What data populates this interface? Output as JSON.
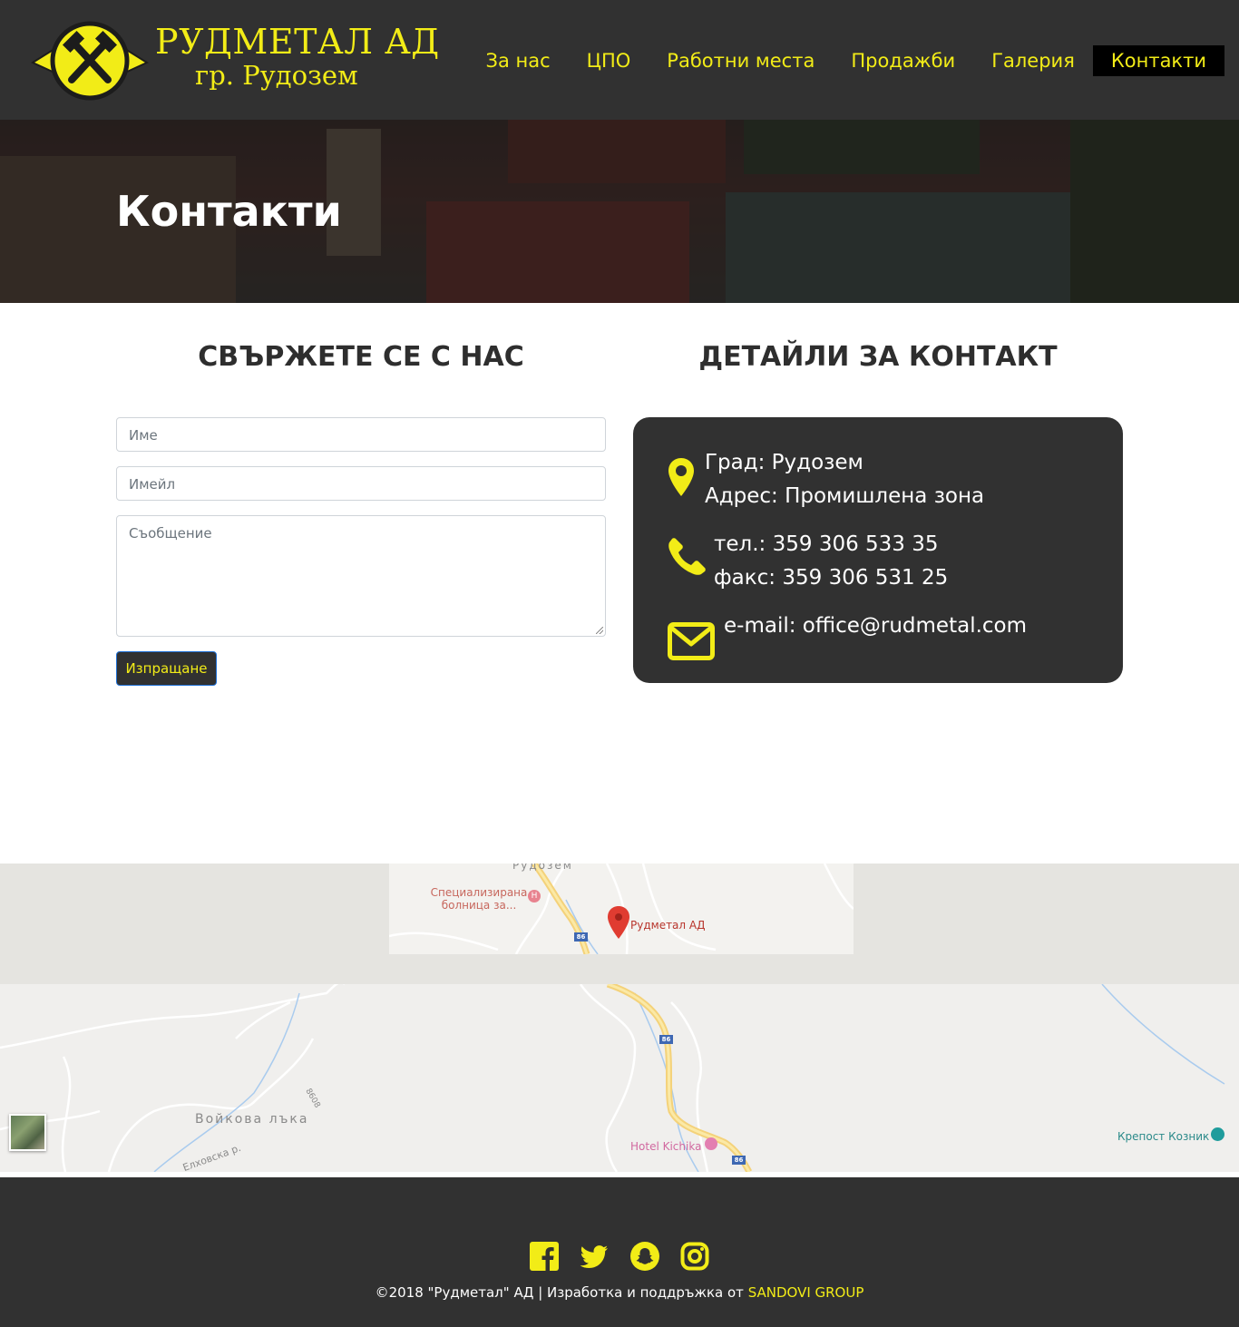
{
  "header": {
    "logo_title": "РУДМЕТАЛ АД",
    "logo_subtitle": "гр. Рудозем",
    "nav": [
      {
        "label": "За нас"
      },
      {
        "label": "ЦПО"
      },
      {
        "label": "Работни места"
      },
      {
        "label": "Продажби"
      },
      {
        "label": "Галерия"
      },
      {
        "label": "Контакти",
        "active": true
      }
    ]
  },
  "hero": {
    "title": "Контакти"
  },
  "contact_form": {
    "heading": "СВЪРЖЕТЕ СЕ С НАС",
    "name_placeholder": "Име",
    "email_placeholder": "Имейл",
    "message_placeholder": "Съобщение",
    "submit_label": "Изпращане"
  },
  "contact_details": {
    "heading": "ДЕТАЙЛИ ЗА КОНТАКТ",
    "city": "Град: Рудозем",
    "address": "Адрес: Промишлена зона",
    "phone": "тел.: 359 306 533 35",
    "fax": "факс: 359 306 531 25",
    "email": "e-mail: office@rudmetal.com",
    "icons": [
      "map-pin-icon",
      "phone-icon",
      "envelope-icon"
    ]
  },
  "map": {
    "labels": {
      "town": "Рудозем",
      "hospital": "Специализирана болница за...",
      "marker": "Рудметал АД",
      "village": "Войкова лъка",
      "street": "Елховска р.",
      "hotel": "Hotel Kichika",
      "fortress": "Крепост Козник",
      "road_86": "86",
      "road_8608": "8608"
    }
  },
  "footer": {
    "social": [
      "facebook-icon",
      "twitter-icon",
      "snapchat-icon",
      "instagram-icon"
    ],
    "copyright": "©2018 \"Рудметал\" АД | Изработка и поддръжка от ",
    "developer": "SANDOVI GROUP"
  },
  "colors": {
    "accent": "#f2ec17",
    "dark": "#313131",
    "active_nav": "#000000"
  }
}
